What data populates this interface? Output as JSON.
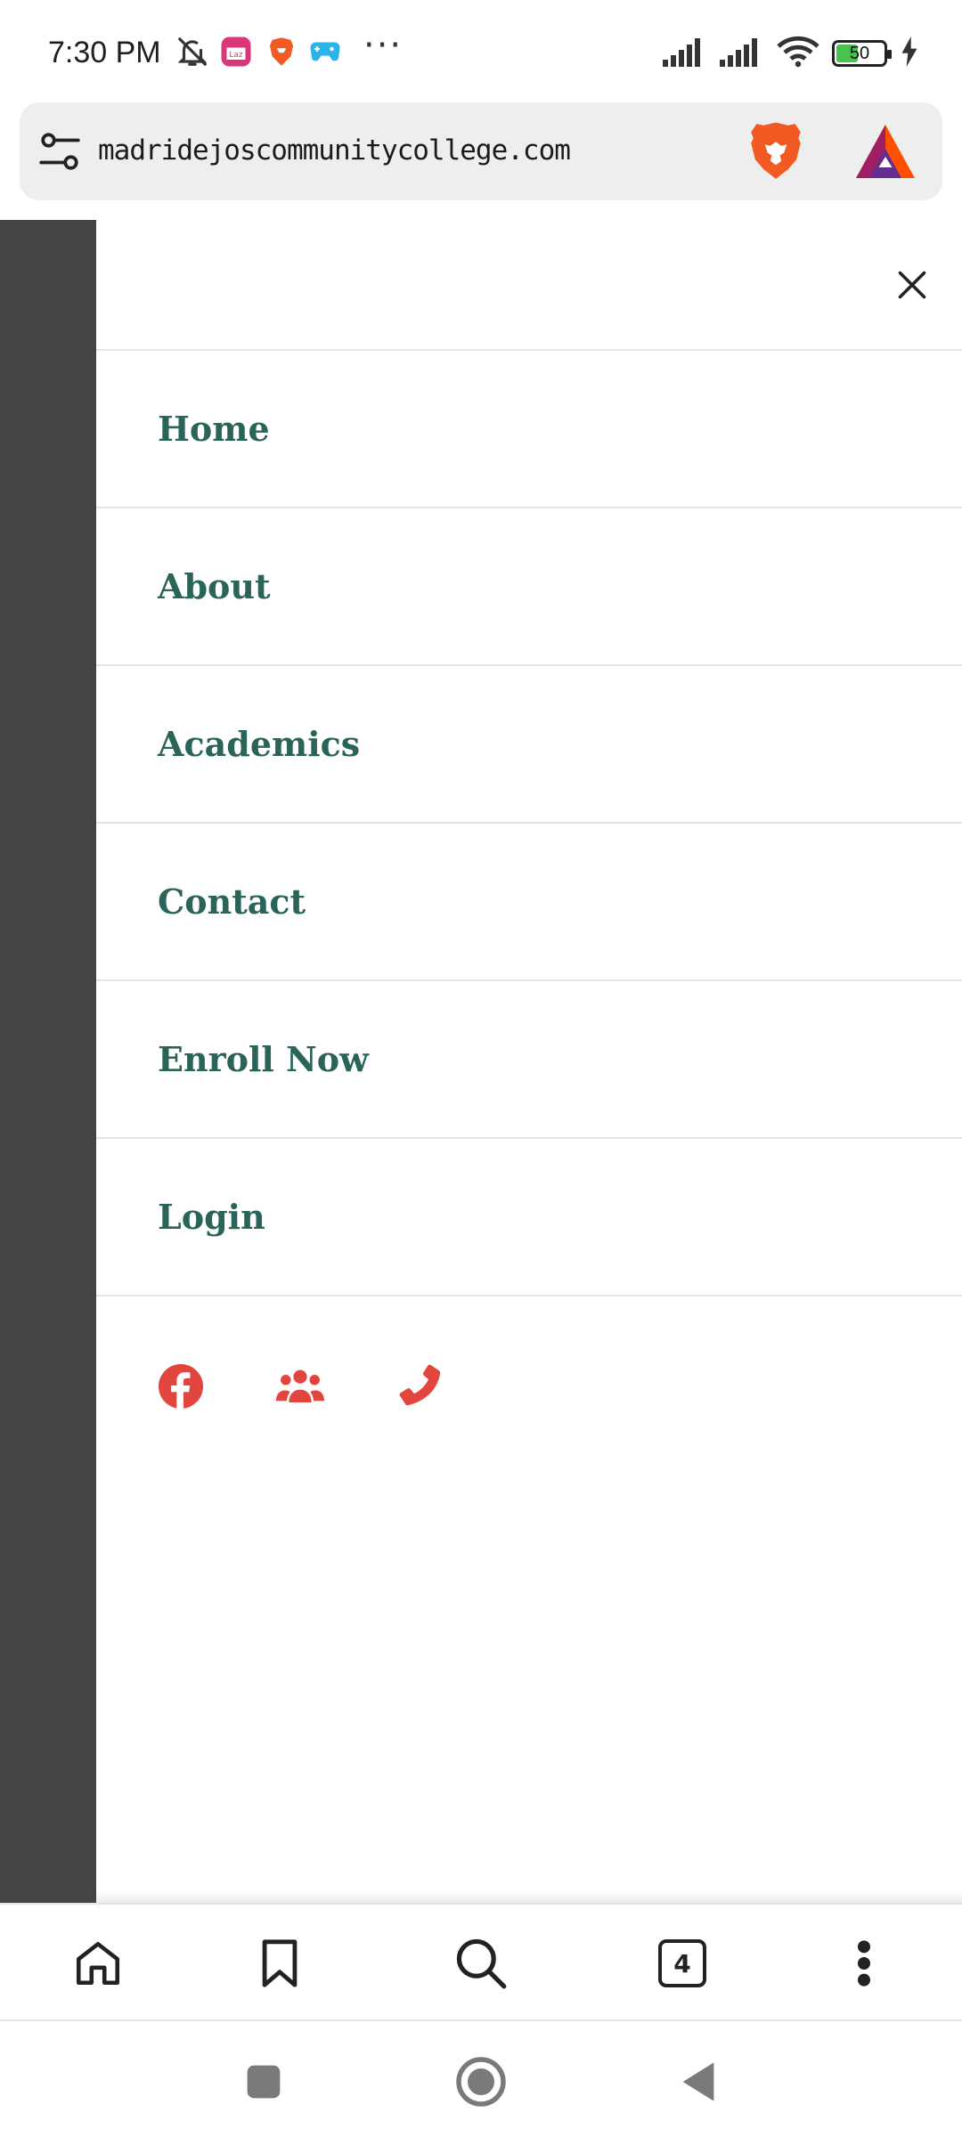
{
  "status_bar": {
    "time": "7:30 PM",
    "battery_level": "50",
    "battery_fraction": 0.5,
    "icons": [
      "bell-off-icon",
      "lazada-icon",
      "brave-icon",
      "gamepad-icon",
      "more-dots-icon",
      "signal-icon",
      "signal-icon",
      "wifi-icon",
      "battery-icon",
      "charging-icon"
    ],
    "more": "···"
  },
  "browser": {
    "url": "madridejoscommunitycollege.com",
    "tab_count": "4"
  },
  "menu": {
    "items": [
      {
        "label": "Home"
      },
      {
        "label": "About"
      },
      {
        "label": "Academics"
      },
      {
        "label": "Contact"
      },
      {
        "label": "Enroll Now"
      },
      {
        "label": "Login"
      }
    ]
  },
  "social": {
    "icons": [
      "facebook-icon",
      "users-icon",
      "phone-icon"
    ]
  },
  "colors": {
    "menu_text": "#2a6358",
    "social_icon": "#e2453e",
    "backdrop": "#444444",
    "brave_orange": "#f15a22"
  }
}
